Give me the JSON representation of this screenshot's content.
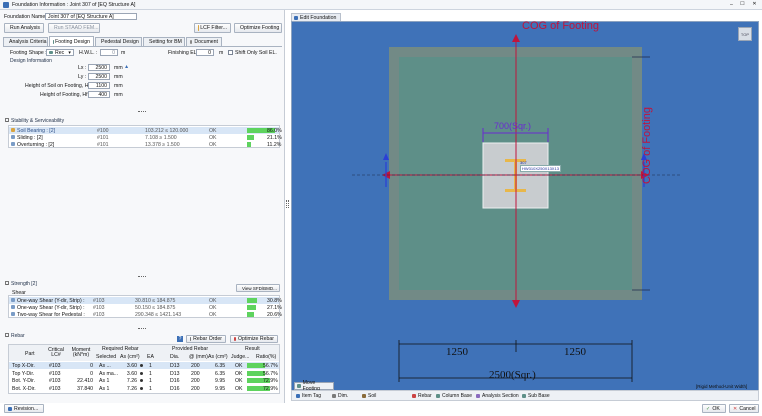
{
  "window": {
    "title": "Foundation Information : Joint 307 of [EQ Structure A]"
  },
  "header": {
    "foundation_name_label": "Foundation Name :",
    "foundation_name_value": "Joint 307 of [EQ Structure A]"
  },
  "toolbar": {
    "run_analysis": "Run Analysis",
    "run_staad": "Run STAAD FEM...",
    "lcf_filter": "LCF Filter...",
    "optimize_footing": "Optimize Footing"
  },
  "tabs": [
    "Analysis Criteria",
    "Footing Design",
    "Pedestal Design",
    "Setting for BM",
    "Document"
  ],
  "footing": {
    "shape_label": "Footing Shape :",
    "shape_value": "Rec",
    "hgl_label": "H.W.L. :",
    "hgl_value": "0",
    "hgl_unit": "m",
    "finishing_label": "Finishing EL. :",
    "finishing_value": "0",
    "finishing_unit": "m",
    "shift_label": "Shift Only Soil EL.",
    "design_info": "Design Information",
    "lx_label": "Lx :",
    "lx_value": "2500",
    "lx_unit": "mm",
    "ly_label": "Ly :",
    "ly_value": "2500",
    "ly_unit": "mm",
    "soil_label": "Height of Soil on Footing, Hs :",
    "soil_value": "1100",
    "soil_unit": "mm",
    "hf_label": "Height of Footing, Hf :",
    "hf_value": "400",
    "hf_unit": "mm"
  },
  "stability": {
    "title": "Stability & Serviceability",
    "rows": [
      {
        "name": "Soil Bearing :  [2]",
        "lc": "#100",
        "value": "103.212  ≤  120.000",
        "status": "OK",
        "ratio": "86.0%",
        "pct": 0.86
      },
      {
        "name": "Sliding :  [2]",
        "lc": "#101",
        "value": "7.108  ≥  1.500",
        "status": "OK",
        "ratio": "21.1%",
        "pct": 0.211
      },
      {
        "name": "Overturning :  [2]",
        "lc": "#101",
        "value": "13.378  ≥  1.500",
        "status": "OK",
        "ratio": "11.2%",
        "pct": 0.112
      }
    ]
  },
  "strength": {
    "title": "Strength  [2]",
    "view_button": "View SFD/BMD...",
    "shear_label": "Shear",
    "rows": [
      {
        "name": "One-way Shear (Y-dir, Strip) :",
        "lc": "#103",
        "value": "30.810  ≤  184.875",
        "status": "OK",
        "ratio": "30.8%",
        "pct": 0.308
      },
      {
        "name": "One-way Shear (Y-dir, Strip) :",
        "lc": "#103",
        "value": "50.150  ≤  184.875",
        "status": "OK",
        "ratio": "27.1%",
        "pct": 0.271
      },
      {
        "name": "Two-way Shear for Pedestal :",
        "lc": "#103",
        "value": "290.348  ≤  1421.143",
        "status": "OK",
        "ratio": "20.6%",
        "pct": 0.206
      }
    ]
  },
  "rebar": {
    "title": "Rebar",
    "rebar_order": "Rebar Order",
    "optimize_rebar": "Optimize Rebar",
    "headers": {
      "part": "Part",
      "critical": "Critical LC#",
      "moment": "Moment (kN*m)",
      "required": "Required Rebar",
      "selected": "Selected",
      "as_req": "As (cm²)",
      "provided": "Provided Rebar",
      "ea": "EA",
      "dia": "Dia.",
      "at": "@ (mm)",
      "as_prov": "As (cm²)",
      "result": "Result",
      "judge": "Judge...",
      "ratio": "Ratio(%)"
    },
    "rows": [
      {
        "part": "Top X-Dir.",
        "lc": "#103",
        "moment": "0",
        "selected": "As ...",
        "as": "3.60",
        "ea": "1",
        "dia": "D13",
        "at": "200",
        "asp": "6.35",
        "judge": "OK",
        "ratio": "56.7%",
        "pct": 0.567
      },
      {
        "part": "Top Y-Dir.",
        "lc": "#103",
        "moment": "0",
        "selected": "As ma...",
        "as": "3.60",
        "ea": "1",
        "dia": "D13",
        "at": "200",
        "asp": "6.35",
        "judge": "OK",
        "ratio": "56.7%",
        "pct": 0.567
      },
      {
        "part": "Bot. Y-Dir.",
        "lc": "#103",
        "moment": "22.410",
        "selected": "As 1",
        "as": "7.26",
        "ea": "1",
        "dia": "D16",
        "at": "200",
        "asp": "9.95",
        "judge": "OK",
        "ratio": "72.9%",
        "pct": 0.729
      },
      {
        "part": "Bot. X-Dir.",
        "lc": "#103",
        "moment": "37.840",
        "selected": "As 1",
        "as": "7.26",
        "ea": "1",
        "dia": "D16",
        "at": "200",
        "asp": "9.95",
        "judge": "OK",
        "ratio": "72.9%",
        "pct": 0.729
      }
    ]
  },
  "status_bar": {
    "revision": "Revision..."
  },
  "viewport": {
    "tab_title": "Edit Foundation",
    "nav_label": "TOP",
    "cog_top": "COG of Footing",
    "cog_right": "COG of Footing",
    "pedestal_dim": "700(Sqr.)",
    "column_tag_1": "307",
    "column_tag_2": "HW310X250X13X13",
    "dim_left": "1250",
    "dim_right": "1250",
    "dim_total": "2500(Sqr.)",
    "method": "[Rigid Method-Unit Width]",
    "move_footing": "Move Footing"
  },
  "bottom_tabs": [
    "Item Tag",
    "Dim.",
    "Soil",
    "Rebar",
    "Column Base",
    "Analysis Section",
    "Sub Base"
  ],
  "footer": {
    "ok": "OK",
    "cancel": "Cancel"
  },
  "colors": {
    "accent": "#3b6fb6",
    "footing": "#5e8f88",
    "soil": "#728a86",
    "cog_line": "#c0143c",
    "dim_line": "#6a2bd1",
    "ok_green": "#5ed35e"
  }
}
